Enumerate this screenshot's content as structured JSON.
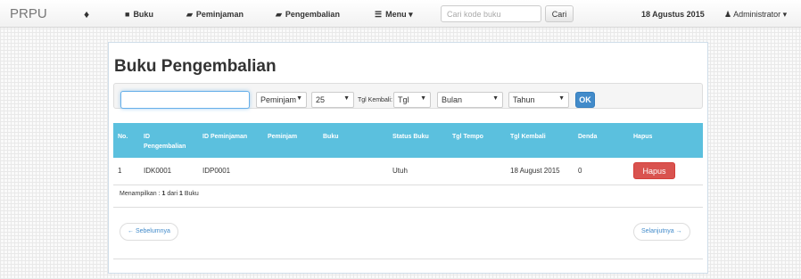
{
  "navbar": {
    "brand": "PRPU",
    "home_icon": "home-icon",
    "items": [
      {
        "label": "Buku",
        "icon": "book-icon",
        "glyph": "■"
      },
      {
        "label": "Peminjaman",
        "icon": "folder-icon",
        "glyph": "▰"
      },
      {
        "label": "Pengembalian",
        "icon": "folder-open-icon",
        "glyph": "▰"
      },
      {
        "label": "Menu ▾",
        "icon": "list-icon",
        "glyph": "☰"
      }
    ],
    "search": {
      "placeholder": "Cari kode buku",
      "value": "",
      "button": "Cari"
    },
    "date": "18 Agustus 2015",
    "user": "Administrator ▾",
    "user_glyph": "♟"
  },
  "page": {
    "title": "Buku Pengembalian"
  },
  "filters": {
    "input_value": "",
    "field_select": "Peminjam",
    "count_select": "25",
    "label": "Tgl Kembali:",
    "day_select": "Tgl",
    "month_select": "Bulan",
    "year_select": "Tahun",
    "ok": "OK"
  },
  "table": {
    "headers": [
      "No.",
      "ID Pengembalian",
      "ID Peminjaman",
      "Peminjam",
      "Buku",
      "Status Buku",
      "Tgl Tempo",
      "Tgl Kembali",
      "Denda",
      "Hapus"
    ],
    "rows": [
      {
        "no": "1",
        "id_pengembalian": "IDK0001",
        "id_peminjaman": "IDP0001",
        "peminjam": "",
        "buku": "",
        "status": "Utuh",
        "tgl_tempo": "",
        "tgl_kembali": "18 August 2015",
        "denda": "0",
        "action": "Hapus"
      }
    ]
  },
  "summary": {
    "prefix": "Menampilkan :",
    "shown": "1",
    "middle": "dari",
    "total": "1",
    "suffix": "Buku"
  },
  "pagination": {
    "prev": "← Sebelumnya",
    "next": "Selanjutnya →"
  },
  "colors": {
    "table_header": "#5bc0de",
    "ok_button": "#428bca",
    "delete_button": "#d9534f"
  }
}
